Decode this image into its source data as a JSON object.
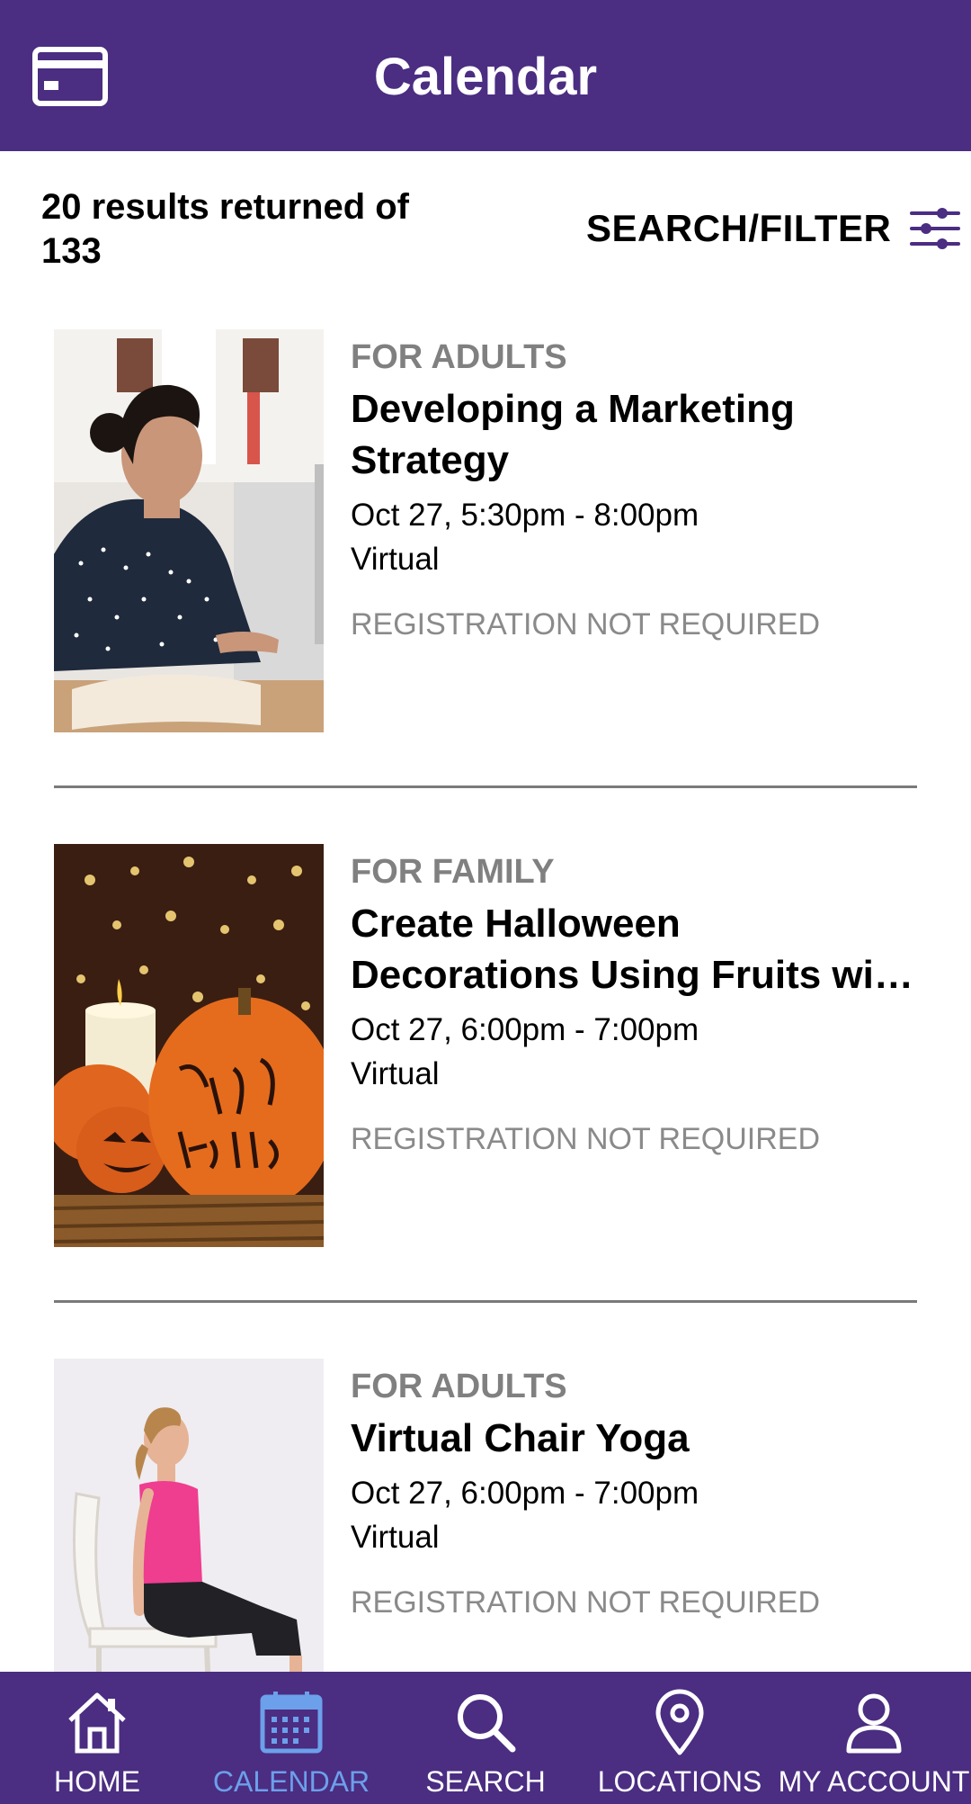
{
  "header": {
    "title": "Calendar"
  },
  "results": {
    "summary": "20 results returned of 133"
  },
  "filter": {
    "label": "SEARCH/FILTER"
  },
  "events": [
    {
      "audience": "FOR ADULTS",
      "title": "Developing a Marketing Strategy",
      "date": "Oct 27, 5:30pm - 8:00pm",
      "location": "Virtual",
      "registration": "REGISTRATION NOT REQUIRED",
      "image": "woman-at-laptop"
    },
    {
      "audience": "FOR FAMILY",
      "title": "Create Halloween Decorations Using Fruits with Kids",
      "date": "Oct 27, 6:00pm - 7:00pm",
      "location": "Virtual",
      "registration": "REGISTRATION NOT REQUIRED",
      "image": "halloween-pumpkins"
    },
    {
      "audience": "FOR ADULTS",
      "title": "Virtual Chair Yoga",
      "date": "Oct 27, 6:00pm - 7:00pm",
      "location": "Virtual",
      "registration": "REGISTRATION NOT REQUIRED",
      "image": "woman-chair-yoga"
    }
  ],
  "nav": {
    "items": [
      {
        "label": "HOME",
        "icon": "home-icon",
        "active": false
      },
      {
        "label": "CALENDAR",
        "icon": "calendar-icon",
        "active": true
      },
      {
        "label": "SEARCH",
        "icon": "search-icon",
        "active": false
      },
      {
        "label": "LOCATIONS",
        "icon": "location-pin-icon",
        "active": false
      },
      {
        "label": "MY ACCOUNT",
        "icon": "account-icon",
        "active": false
      }
    ]
  },
  "colors": {
    "brand": "#4b2d82",
    "active_nav": "#6ca0ea",
    "muted_text": "#808080"
  }
}
